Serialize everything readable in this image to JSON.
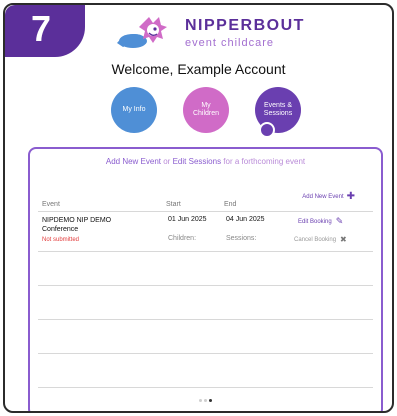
{
  "step": {
    "number": "7"
  },
  "brand": {
    "name": "NIPPERBOUT",
    "subtitle": "event childcare",
    "colors": {
      "purple": "#5b2f9a",
      "blue": "#4f8fd6",
      "pink": "#d06bc7",
      "violet": "#6a3fb0"
    }
  },
  "welcome": {
    "text": "Welcome, Example Account"
  },
  "nav": [
    {
      "label_line1": "My Info",
      "label_line2": ""
    },
    {
      "label_line1": "My",
      "label_line2": "Children"
    },
    {
      "label_line1": "Events &",
      "label_line2": "Sessions"
    }
  ],
  "panel": {
    "title_part1": "Add New Event",
    "title_or": "or",
    "title_part2": "Edit Sessions",
    "title_part3": "for a forthcoming event",
    "add_new": "Add New Event",
    "columns": {
      "event": "Event",
      "start": "Start",
      "end": "End"
    },
    "rows": [
      {
        "event_line1": "NIPDEMO NIP DEMO",
        "event_line2": "Conference",
        "status": "Not submitted",
        "start": "01 Jun 2025",
        "end": "04 Jun 2025",
        "children_label": "Children:",
        "sessions_label": "Sessions:",
        "edit": "Edit Booking",
        "cancel": "Cancel Booking"
      }
    ]
  },
  "pagination": {
    "total": 3,
    "active": 3
  }
}
